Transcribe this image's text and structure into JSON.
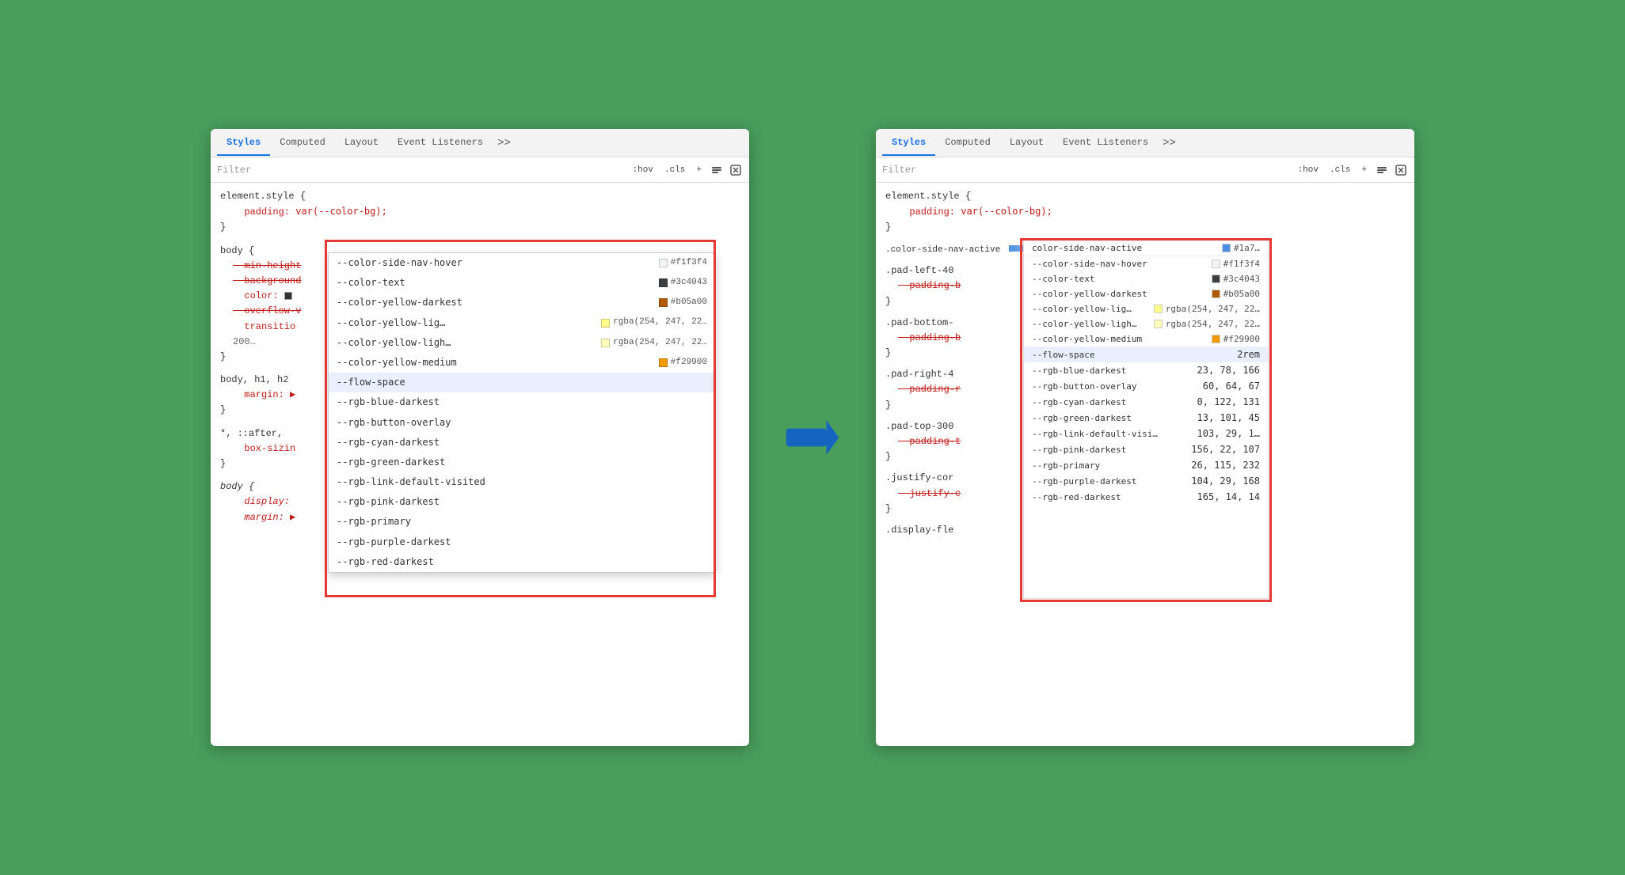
{
  "left_panel": {
    "tabs": [
      "Styles",
      "Computed",
      "Layout",
      "Event Listeners",
      ">>"
    ],
    "active_tab": "Styles",
    "filter_placeholder": "Filter",
    "filter_buttons": [
      ":hov",
      ".cls",
      "+"
    ],
    "style_rules": [
      {
        "selector": "element.style {",
        "properties": [
          {
            "name": "padding:",
            "value": "var(--color-bg);"
          }
        ],
        "close": "}"
      },
      {
        "selector": "body {",
        "properties": [
          {
            "name": "min-height",
            "value": "",
            "strikethrough": true
          },
          {
            "name": "background",
            "value": "",
            "strikethrough": true
          },
          {
            "name": "color:",
            "value": "■",
            "strikethrough": false
          },
          {
            "name": "overflow-v",
            "value": "",
            "strikethrough": true
          },
          {
            "name": "transitio",
            "value": "",
            "strikethrough": false
          }
        ],
        "close": "200..."
      },
      {
        "selector": "body, h1, h2",
        "properties": [
          {
            "name": "margin:",
            "value": "▶"
          }
        ],
        "close": "}"
      },
      {
        "selector": "*, ::after,",
        "properties": [
          {
            "name": "box-sizin",
            "value": ""
          }
        ],
        "close": "}"
      },
      {
        "selector": "body {",
        "properties": [
          {
            "name": "display:",
            "value": "",
            "italic": true
          },
          {
            "name": "margin:",
            "value": "▶",
            "italic": true
          }
        ]
      }
    ],
    "autocomplete": {
      "items": [
        {
          "name": "--color-side-nav-hover",
          "swatch_color": "#f1f3f4",
          "swatch_border": "#ccc",
          "value": "#f1f3f4"
        },
        {
          "name": "--color-text",
          "swatch_color": "#3c4043",
          "value": "#3c4043"
        },
        {
          "name": "--color-yellow-darkest",
          "swatch_color": "#b05a00",
          "value": "#b05a00"
        },
        {
          "name": "--color-yellow-lig…",
          "swatch_color": "rgba(254,247,22,0.5)",
          "value": "rgba(254, 247, 22…"
        },
        {
          "name": "--color-yellow-ligh…",
          "swatch_color": "rgba(254,247,22,0.3)",
          "value": "rgba(254, 247, 22…"
        },
        {
          "name": "--color-yellow-medium",
          "swatch_color": "#f29900",
          "value": "#f29900"
        },
        {
          "name": "--flow-space",
          "value": "",
          "selected": true
        },
        {
          "name": "--rgb-blue-darkest",
          "value": ""
        },
        {
          "name": "--rgb-button-overlay",
          "value": ""
        },
        {
          "name": "--rgb-cyan-darkest",
          "value": ""
        },
        {
          "name": "--rgb-green-darkest",
          "value": ""
        },
        {
          "name": "--rgb-link-default-visited",
          "value": ""
        },
        {
          "name": "--rgb-pink-darkest",
          "value": ""
        },
        {
          "name": "--rgb-primary",
          "value": ""
        },
        {
          "name": "--rgb-purple-darkest",
          "value": ""
        },
        {
          "name": "--rgb-red-darkest",
          "value": ""
        }
      ]
    }
  },
  "right_panel": {
    "tabs": [
      "Styles",
      "Computed",
      "Layout",
      "Event Listeners",
      ">>"
    ],
    "active_tab": "Styles",
    "filter_placeholder": "Filter",
    "style_rules": [
      {
        "selector": "element.style {",
        "properties": [
          {
            "name": "padding:",
            "value": "var(--color-bg);"
          }
        ],
        "close": "}"
      },
      {
        "selector": ".color-side-nav-active",
        "truncated": true,
        "properties": []
      },
      {
        "selector": ".pad-left-40",
        "truncated": true,
        "properties": [
          {
            "name": "padding-b",
            "value": "",
            "strikethrough": true
          }
        ],
        "close": "}"
      },
      {
        "selector": ".pad-bottom-",
        "truncated": true,
        "properties": [
          {
            "name": "padding-b",
            "value": "",
            "strikethrough": true
          }
        ],
        "close": "}"
      },
      {
        "selector": ".pad-right-4",
        "truncated": true,
        "properties": [
          {
            "name": "padding-r",
            "value": "",
            "strikethrough": true
          }
        ],
        "close": "}"
      },
      {
        "selector": ".pad-top-300",
        "truncated": true,
        "properties": [
          {
            "name": "padding-t",
            "value": "",
            "strikethrough": true
          }
        ],
        "close": "}"
      },
      {
        "selector": ".justify-cor",
        "truncated": true,
        "properties": [
          {
            "name": "justify-c",
            "value": "",
            "strikethrough": true
          }
        ],
        "close": "}"
      },
      {
        "selector": ".display-fle",
        "truncated": true,
        "properties": []
      }
    ],
    "computed_vars": [
      {
        "name": "--color-side-nav-hover",
        "swatch_color": "#f1f3f4",
        "value": "#f1f3f4"
      },
      {
        "name": "--color-text",
        "swatch_color": "#3c4043",
        "value": "#3c4043"
      },
      {
        "name": "--color-yellow-darkest",
        "swatch_color": "#b05a00",
        "value": "#b05a00"
      },
      {
        "name": "--color-yellow-lig…",
        "swatch_color": "rgba(254,247,22,0.4)",
        "value": "rgba(254, 247, 22…"
      },
      {
        "name": "--color-yellow-ligh…",
        "swatch_color": "rgba(254,247,22,0.3)",
        "value": "rgba(254, 247, 22…"
      },
      {
        "name": "--color-yellow-medium",
        "swatch_color": "#f29900",
        "value": "#f29900"
      },
      {
        "name": "--flow-space",
        "value": "2rem",
        "selected": true
      },
      {
        "name": "--rgb-blue-darkest",
        "value": "23, 78, 166"
      },
      {
        "name": "--rgb-button-overlay",
        "value": "60, 64, 67"
      },
      {
        "name": "--rgb-cyan-darkest",
        "value": "0, 122, 131"
      },
      {
        "name": "--rgb-green-darkest",
        "value": "13, 101, 45"
      },
      {
        "name": "--rgb-link-default-visited…",
        "value": "103, 29, 1…"
      },
      {
        "name": "--rgb-pink-darkest",
        "value": "156, 22, 107"
      },
      {
        "name": "--rgb-primary",
        "value": "26, 115, 232"
      },
      {
        "name": "--rgb-purple-darkest",
        "value": "104, 29, 168"
      },
      {
        "name": "--rgb-red-darkest",
        "value": "165, 14, 14"
      }
    ]
  },
  "arrow": {
    "color": "#1565c0",
    "label": "→"
  },
  "annotations": {
    "left_red_box": "CSS variable autocomplete dropdown",
    "right_red_box": "Computed CSS variable values"
  }
}
